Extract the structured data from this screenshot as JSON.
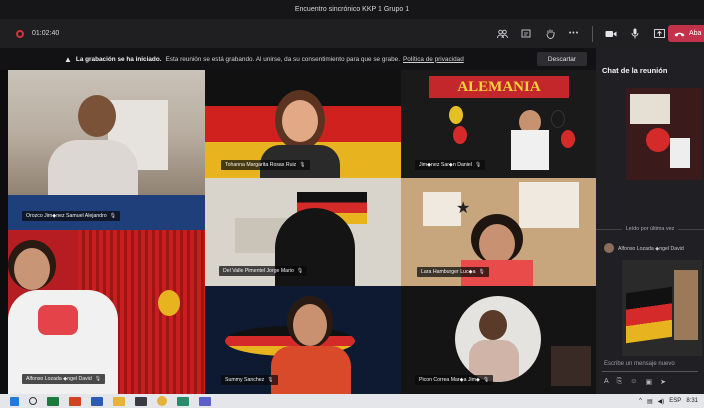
{
  "window": {
    "title": "Encuentro sincrónico KKP 1 Grupo 1"
  },
  "toolbar": {
    "timer": "01:02:40",
    "icons": [
      "people-icon",
      "chat-icon",
      "raise-hand-icon",
      "more-icon",
      "camera-icon",
      "mic-icon",
      "share-icon",
      "phone-icon"
    ],
    "more_label": "•••",
    "leave_label": "Aba"
  },
  "banner": {
    "title": "La grabación se ha iniciado.",
    "text": "Esta reunión se está grabando. Al unirse, da su consentimiento para que se grabe.",
    "link": "Política de privacidad",
    "dismiss": "Descartar"
  },
  "participants": [
    {
      "name": "Orozco Jim◆nez Samuel Alejandro"
    },
    {
      "name": "Tohanna Margarita Rosas Ruiz"
    },
    {
      "name": "Jim◆nez Sar◆n Daniel"
    },
    {
      "name": "Del Valle Pimentel Jorge Mario"
    },
    {
      "name": "Lara Hamburger Luc◆a"
    },
    {
      "name": "Alfonso Lozada ◆ngel David"
    },
    {
      "name": "Summy Sanchez"
    },
    {
      "name": "Picon Correa Mar◆a Jim◆"
    }
  ],
  "tile_labels": {
    "alemania": "ALEMANIA"
  },
  "chat": {
    "title": "Chat de la reunión",
    "last_read": "Leído por última vez",
    "author": "Alfonso Lozada ◆ngel David",
    "compose_placeholder": "Escribe un mensaje nuevo"
  },
  "taskbar": {
    "language": "ESP",
    "time": "8:31"
  },
  "colors": {
    "accent": "#c4314b",
    "teams_bg": "#201f24",
    "record": "#d13438"
  }
}
